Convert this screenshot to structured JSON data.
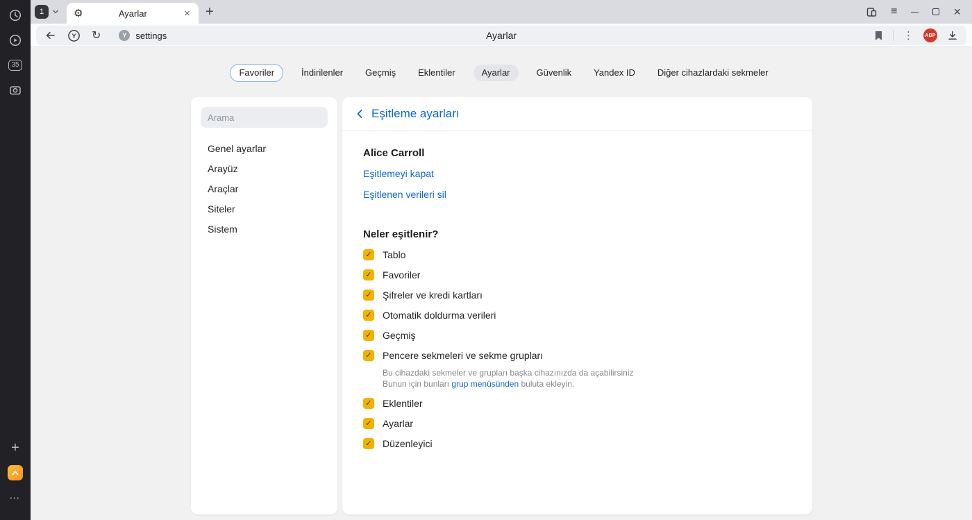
{
  "icons": {
    "gear": "⚙",
    "close": "×",
    "plus": "+",
    "menu": "≡",
    "dots_vertical": "⋮",
    "dots_horizontal": "⋯",
    "refresh": "↻",
    "check": "✓",
    "favicon_letter": "Y",
    "y_circle_letter": "Y"
  },
  "colors": {
    "accent_blue": "#0f68d0",
    "checkbox_yellow": "#f2b202",
    "abp_red": "#d5372d"
  },
  "rail": {
    "tab_count_badge": "35"
  },
  "chrome": {
    "tab_counter": "1",
    "active_tab_title": "Ayarlar"
  },
  "omnibar": {
    "url": "settings",
    "page_title": "Ayarlar",
    "abp_badge": "ABP"
  },
  "nav": {
    "items": [
      {
        "label": "Favoriler"
      },
      {
        "label": "İndirilenler"
      },
      {
        "label": "Geçmiş"
      },
      {
        "label": "Eklentiler"
      },
      {
        "label": "Ayarlar"
      },
      {
        "label": "Güvenlik"
      },
      {
        "label": "Yandex ID"
      },
      {
        "label": "Diğer cihazlardaki sekmeler"
      }
    ]
  },
  "menu": {
    "search_placeholder": "Arama",
    "items": [
      {
        "label": "Genel ayarlar"
      },
      {
        "label": "Arayüz"
      },
      {
        "label": "Araçlar"
      },
      {
        "label": "Siteler"
      },
      {
        "label": "Sistem"
      }
    ]
  },
  "sync": {
    "title": "Eşitleme ayarları",
    "account_name": "Alice Carroll",
    "link_disable": "Eşitlemeyi kapat",
    "link_delete": "Eşitlenen verileri sil",
    "section_title": "Neler eşitlenir?",
    "items": [
      {
        "label": "Tablo",
        "checked": true
      },
      {
        "label": "Favoriler",
        "checked": true
      },
      {
        "label": "Şifreler ve kredi kartları",
        "checked": true
      },
      {
        "label": "Otomatik doldurma verileri",
        "checked": true
      },
      {
        "label": "Geçmiş",
        "checked": true
      },
      {
        "label": "Pencere sekmeleri ve sekme grupları",
        "checked": true,
        "desc_line1": "Bu cihazdaki sekmeler ve grupları başka cihazınızda da açabilirsiniz",
        "desc_line2_prefix": "Bunun için bunları ",
        "desc_link": "grup menüsünden",
        "desc_line2_suffix": " buluta ekleyin."
      },
      {
        "label": "Eklentiler",
        "checked": true
      },
      {
        "label": "Ayarlar",
        "checked": true
      },
      {
        "label": "Düzenleyici",
        "checked": true
      }
    ]
  }
}
